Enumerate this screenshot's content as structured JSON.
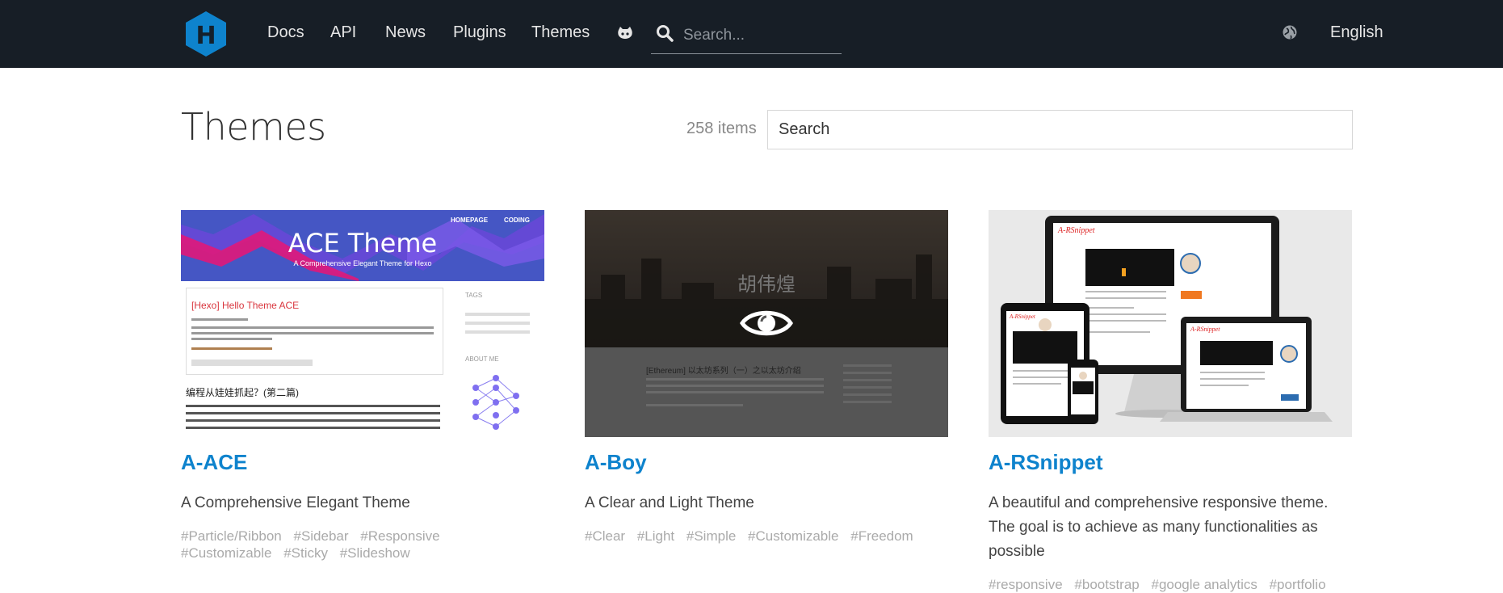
{
  "nav": {
    "logo_letter": "H",
    "links": [
      "Docs",
      "API",
      "News",
      "Plugins",
      "Themes"
    ],
    "search_placeholder": "Search...",
    "language": "English"
  },
  "page": {
    "title": "Themes",
    "item_count": "258 items",
    "search_placeholder": "Search"
  },
  "themes": [
    {
      "name": "A-ACE",
      "description": "A Comprehensive Elegant Theme",
      "tags": [
        "#Particle/Ribbon",
        "#Sidebar",
        "#Responsive",
        "#Customizable",
        "#Sticky",
        "#Slideshow"
      ],
      "preview": {
        "banner_title": "ACE Theme",
        "banner_subtitle": "A Comprehensive Elegant Theme for Hexo",
        "nav_homepage": "HOMEPAGE",
        "nav_coding": "CODING",
        "post_title": "[Hexo] Hello Theme ACE",
        "sidebar_tags": "TAGS",
        "sidebar_about": "ABOUT ME",
        "post2_title": "编程从娃娃抓起？(第二篇)"
      }
    },
    {
      "name": "A-Boy",
      "description": "A Clear and Light Theme",
      "tags": [
        "#Clear",
        "#Light",
        "#Simple",
        "#Customizable",
        "#Freedom"
      ],
      "preview": {
        "site_name": "胡伟煌",
        "post_title": "[Ethereum] 以太坊系列（一）之以太坊介绍"
      }
    },
    {
      "name": "A-RSnippet",
      "description": "A beautiful and comprehensive responsive theme. The goal is to achieve as many functionalities as possible",
      "tags": [
        "#responsive",
        "#bootstrap",
        "#google analytics",
        "#portfolio"
      ],
      "preview": {
        "site_name": "A-RSnippet"
      }
    }
  ],
  "colors": {
    "header_bg": "#171e26",
    "link_blue": "#0e83cd",
    "logo_blue": "#0e83cd"
  }
}
